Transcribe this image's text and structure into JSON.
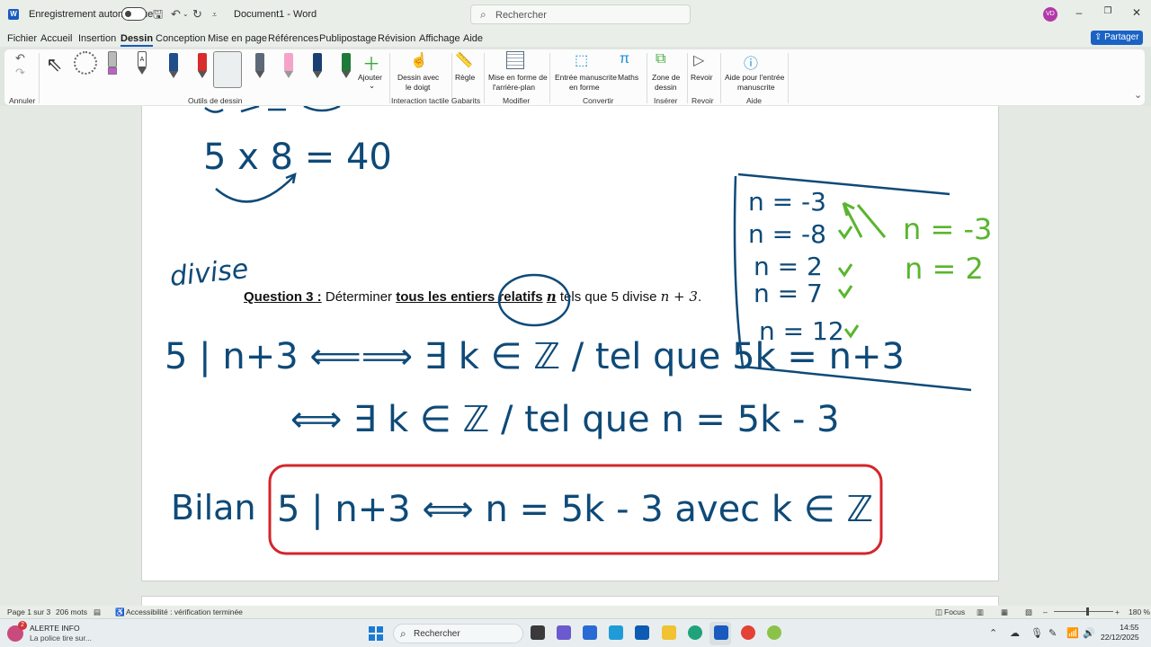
{
  "titlebar": {
    "logo": "W",
    "autosave_label": "Enregistrement automatique",
    "doc_title": "Document1 - Word",
    "search_placeholder": "Rechercher",
    "avatar_initials": "VD"
  },
  "menu": {
    "tabs": [
      "Fichier",
      "Accueil",
      "Insertion",
      "Dessin",
      "Conception",
      "Mise en page",
      "Références",
      "Publipostage",
      "Révision",
      "Affichage",
      "Aide"
    ],
    "active_tab": "Dessin",
    "share_label": "Partager"
  },
  "ribbon": {
    "groups": {
      "annuler": "Annuler",
      "outils": "Outils de dessin",
      "interaction": "Interaction tactile",
      "gabarits": "Gabarits",
      "modifier": "Modifier",
      "convertir": "Convertir",
      "inserer": "Insérer",
      "revoir": "Revoir",
      "aide": "Aide"
    },
    "buttons": {
      "ajouter": "Ajouter",
      "dessin_doigt_1": "Dessin avec",
      "dessin_doigt_2": "le doigt",
      "regle": "Règle",
      "mise_en_forme_1": "Mise en forme de",
      "mise_en_forme_2": "l'arrière-plan",
      "entree_1": "Entrée manuscrite",
      "entree_2": "en forme",
      "maths": "Maths",
      "zone_1": "Zone de",
      "zone_2": "dessin",
      "revoir": "Revoir",
      "aide_1": "Aide pour l'entrée",
      "aide_2": "manuscrite"
    },
    "pens": [
      {
        "name": "pen-navy",
        "color": "#1f4e8c"
      },
      {
        "name": "pen-red",
        "color": "#d92b2b"
      },
      {
        "name": "pen-green-selected",
        "color": "#4fbf3a"
      },
      {
        "name": "pen-gray",
        "color": "#5c6a78"
      },
      {
        "name": "highlighter-pink",
        "color": "#f5a3c9"
      },
      {
        "name": "pen-darkblue",
        "color": "#1c3f73"
      },
      {
        "name": "pen-darkgreen",
        "color": "#1f7a3a"
      }
    ]
  },
  "document": {
    "question_label": "Question 3 :",
    "question_text_1": "Déterminer",
    "question_bold": "tous les entiers relatifs",
    "question_var": "n",
    "question_text_2": "tels que 5 divise",
    "question_expr": "n + 3",
    "question_end": "."
  },
  "ink": {
    "line_5x8": "5 x 8 = 40",
    "divise": "divise",
    "eq1": "5 | n+3  ⟸⟹  ∃ k ∈ ℤ /  tel que  5k = n+3",
    "eq2": "⟺  ∃ k ∈ ℤ /  tel que  n = 5k - 3",
    "bilan_label": "Bilan",
    "bilan_eq": "5 | n+3  ⟺  n = 5k - 3  avec k ∈ ℤ",
    "side_values": [
      "n = -3",
      "n = -8",
      "n = 2",
      "n = 7",
      "n = 12"
    ],
    "green_answers": [
      "n = -3",
      "n = 2"
    ]
  },
  "status": {
    "page": "Page 1 sur 3",
    "words": "206 mots",
    "accessibility": "Accessibilité : vérification terminée",
    "focus": "Focus",
    "zoom": "180 %"
  },
  "taskbar": {
    "alert_count": "2",
    "alert_title": "ALERTE INFO",
    "alert_sub": "La police tire sur...",
    "search": "Rechercher",
    "time": "14:55",
    "date": "22/12/2025"
  }
}
